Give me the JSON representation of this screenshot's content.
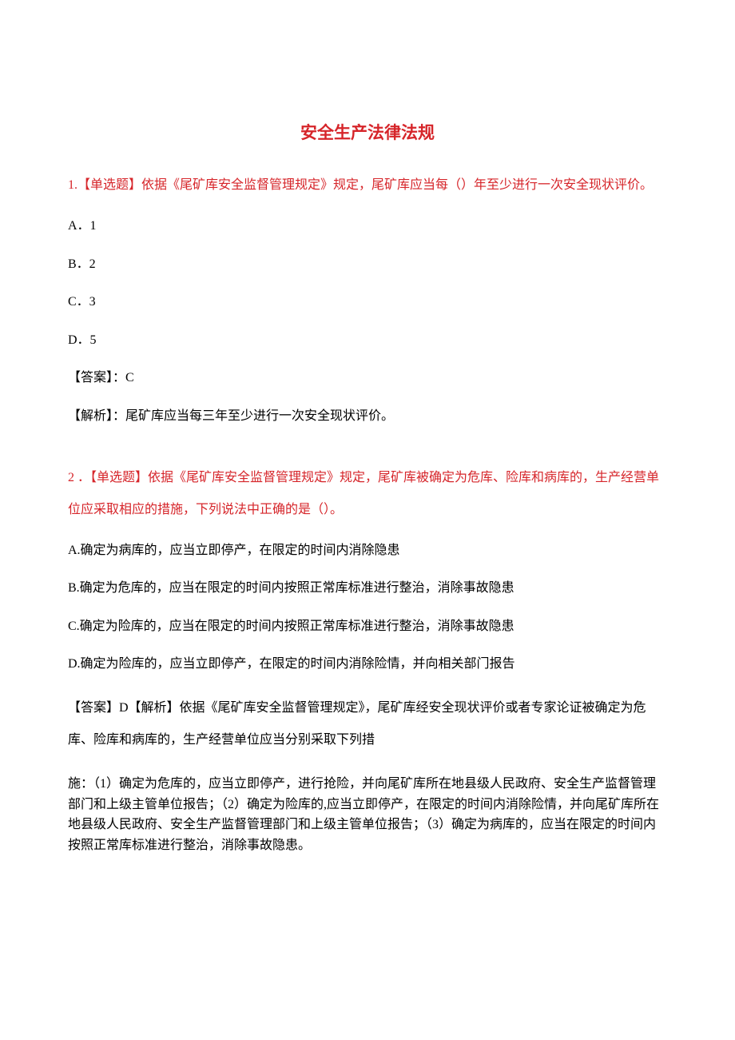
{
  "title": "安全生产法律法规",
  "q1": {
    "prompt": "1.【单选题】依据《尾矿库安全监督管理规定》规定，尾矿库应当每（）年至少进行一次安全现状评价。",
    "optA": "A．1",
    "optB": "B．2",
    "optC": "C．3",
    "optD": "D．5",
    "answer": "【答案】：C",
    "explain": "【解析】：尾矿库应当每三年至少进行一次安全现状评价。"
  },
  "q2": {
    "prompt": "2 ．【单选题】依据《尾矿库安全监督管理规定》规定，尾矿库被确定为危库、险库和病库的，生产经营单位应采取相应的措施，下列说法中正确的是（）。",
    "optA": "A.确定为病库的，应当立即停产，在限定的时间内消除隐患",
    "optB": "B.确定为危库的，应当在限定的时间内按照正常库标准进行整治，消除事故隐患",
    "optC": "C.确定为险库的，应当在限定的时间内按照正常库标准进行整治，消除事故隐患",
    "optD": "D.确定为险库的，应当立即停产，在限定的时间内消除险情，并向相关部门报告",
    "answer": "【答案】D【解析】依据《尾矿库安全监督管理规定》，尾矿库经安全现状评价或者专家论证被确定为危库、险库和病库的，生产经营单位应当分别采取下列措",
    "final": "施：（1）确定为危库的，应当立即停产，进行抢险，并向尾矿库所在地县级人民政府、安全生产监督管理部门和上级主管单位报告；（2）确定为险库的,应当立即停产，在限定的时间内消除险情，并向尾矿库所在地县级人民政府、安全生产监督管理部门和上级主管单位报告；（3）确定为病库的，应当在限定的时间内按照正常库标准进行整治，消除事故隐患。"
  }
}
